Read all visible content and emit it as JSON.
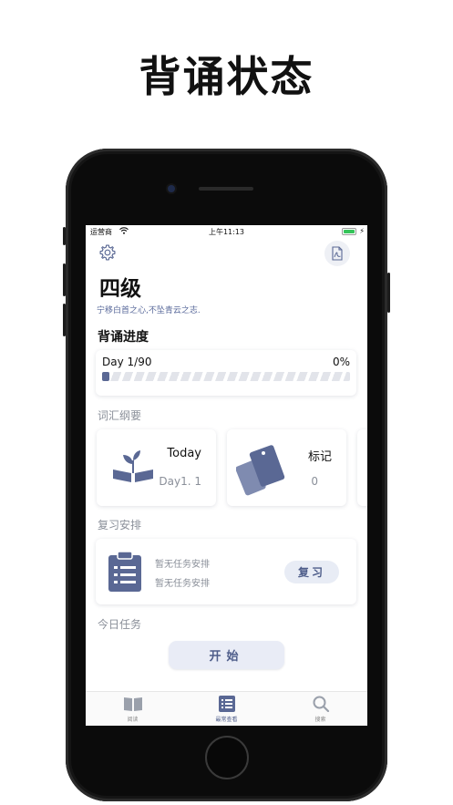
{
  "promo": {
    "title": "背诵状态"
  },
  "statusbar": {
    "carrier": "运营商",
    "time": "上午11:13"
  },
  "book": {
    "title": "四级",
    "motto": "宁移白首之心,不坠青云之志."
  },
  "progress": {
    "section_title": "背诵进度",
    "day": "Day 1/90",
    "percent": "0%",
    "fill_fraction": 0.03
  },
  "vocab": {
    "section_title": "词汇纲要",
    "cards": [
      {
        "title": "Today",
        "value": "Day1. 1",
        "icon": "plant-book-icon"
      },
      {
        "title": "标记",
        "value": "0",
        "icon": "cards-icon"
      }
    ]
  },
  "review": {
    "section_title": "复习安排",
    "line1": "暂无任务安排",
    "line2": "暂无任务安排",
    "button": "复习"
  },
  "today_task": {
    "section_title": "今日任务",
    "start_button": "开始"
  },
  "tabs": [
    {
      "label": "阅读",
      "icon": "book-icon"
    },
    {
      "label": "最常查看",
      "icon": "list-icon",
      "active": true
    },
    {
      "label": "搜索",
      "icon": "search-icon"
    }
  ],
  "colors": {
    "accent": "#5a6894",
    "accent_light": "#e8ecf5",
    "muted": "#8a8f99"
  }
}
